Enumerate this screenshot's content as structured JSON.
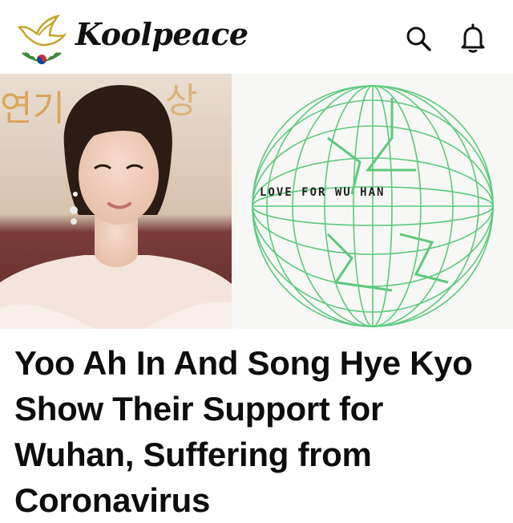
{
  "header": {
    "brand_name": "Koolpeace",
    "logo_icon": "dove-logo-icon",
    "search_icon": "search-icon",
    "bell_icon": "bell-icon"
  },
  "hero": {
    "left_image": "portrait-photo",
    "right_image_caption": "LOVE FOR WU HAN"
  },
  "article": {
    "headline": "Yoo Ah In And Song Hye Kyo Show Their Support for Wuhan, Suffering from Coronavirus"
  },
  "colors": {
    "background": "#ffffff",
    "text": "#0d0d0d",
    "globe_green": "#5cc97a",
    "logo_gold": "#c9a227"
  }
}
